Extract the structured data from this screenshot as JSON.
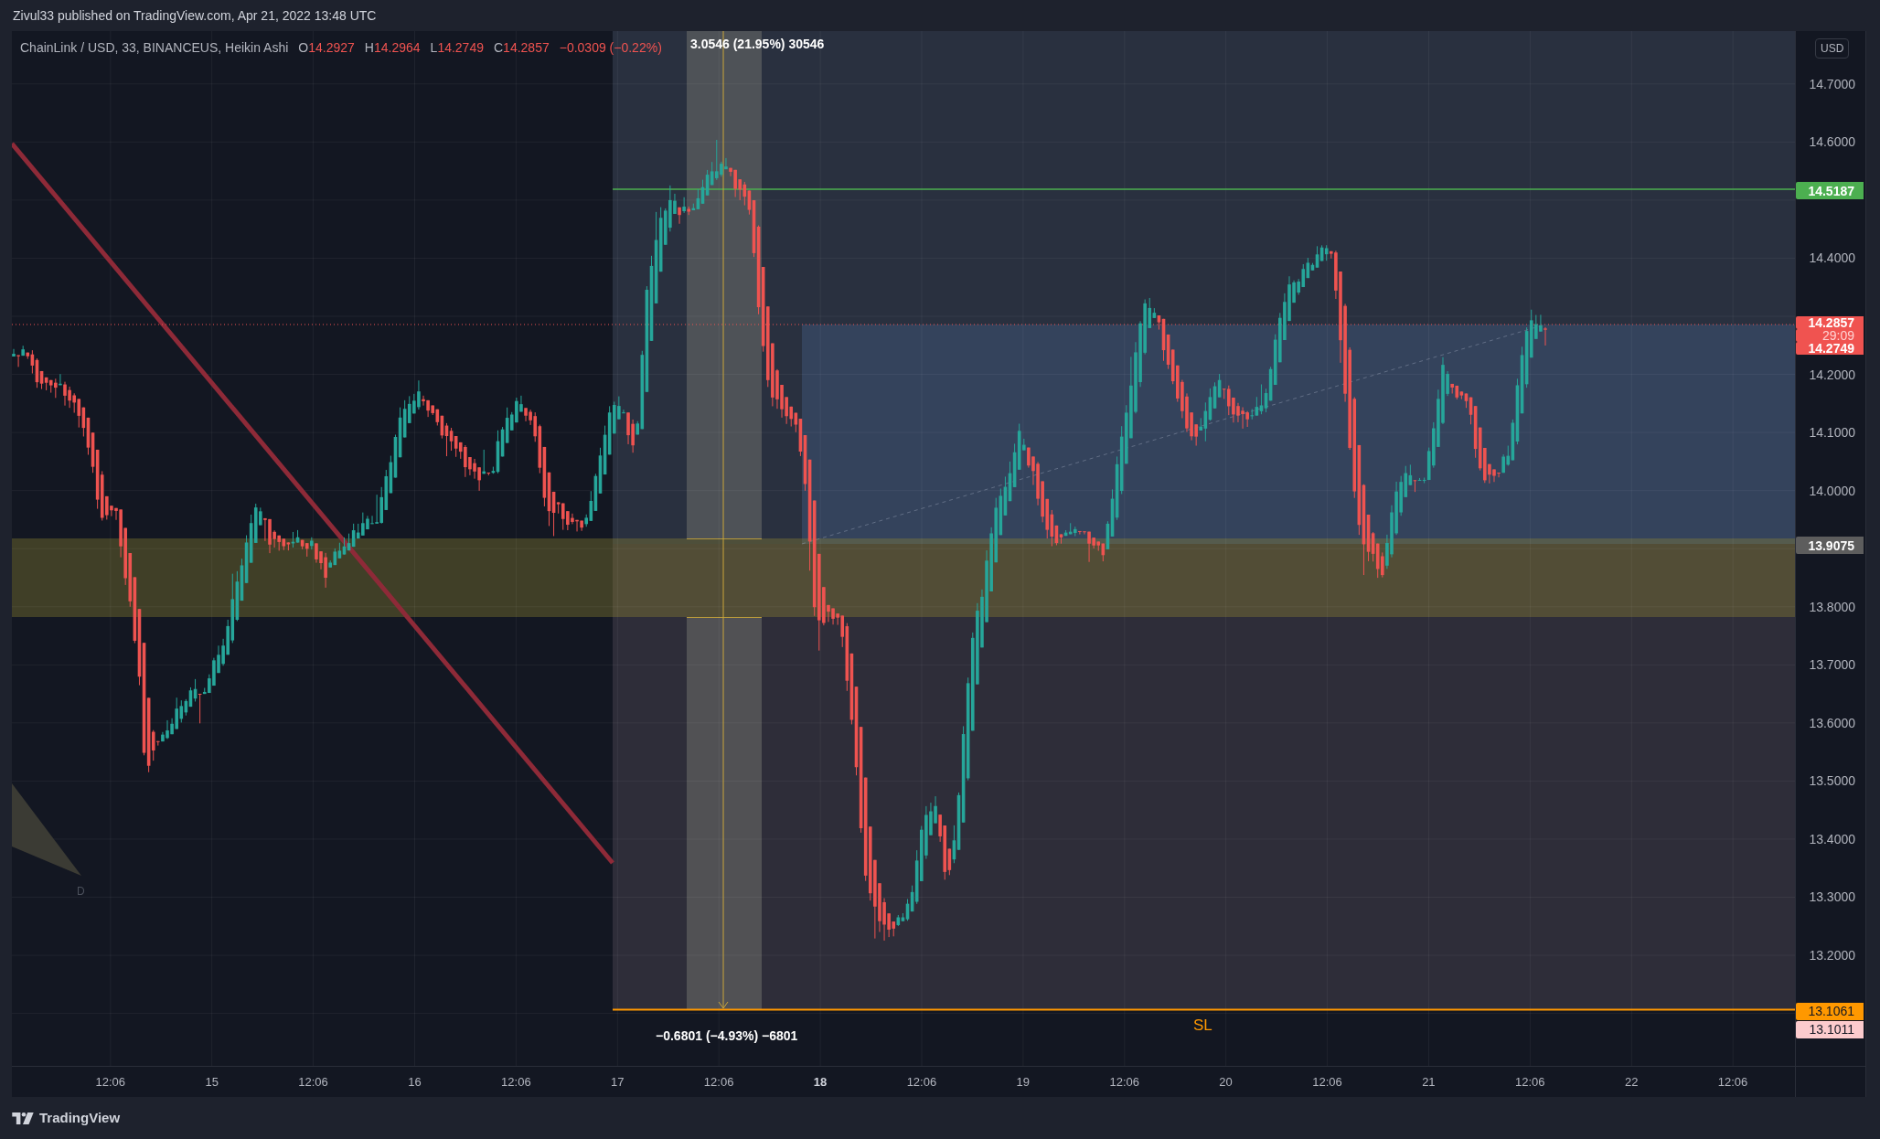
{
  "header": {
    "caption": "Zivul33 published on TradingView.com, Apr 21, 2022 13:48 UTC"
  },
  "legend": {
    "symbol": "ChainLink / USD, 33, BINANCEUS, Heikin Ashi",
    "ohlc": [
      {
        "label": "O",
        "value": "14.2927"
      },
      {
        "label": "H",
        "value": "14.2964"
      },
      {
        "label": "L",
        "value": "14.2749"
      },
      {
        "label": "C",
        "value": "14.2857"
      }
    ],
    "change": "−0.0309 (−0.22%)"
  },
  "drawings": {
    "measure_up": "3.0546 (21.95%) 30546",
    "measure_down": "−0.6801 (−4.93%) −6801",
    "stop_label": "SL",
    "pattern_label": "D"
  },
  "price_axis": {
    "unit": "USD",
    "labels": [
      {
        "kind": "tick",
        "text": "14.7000"
      },
      {
        "kind": "tick",
        "text": "14.6000"
      },
      {
        "kind": "target",
        "text": "14.5187",
        "color": "#4caf50"
      },
      {
        "kind": "tick",
        "text": "14.4000"
      },
      {
        "kind": "last",
        "text": "14.2857",
        "countdown": "29:09",
        "low": "14.2749",
        "color": "#f05350"
      },
      {
        "kind": "tick",
        "text": "14.2000"
      },
      {
        "kind": "tick",
        "text": "14.1000"
      },
      {
        "kind": "tick",
        "text": "14.0000"
      },
      {
        "kind": "entry",
        "text": "13.9075",
        "color": "#5d5d5d"
      },
      {
        "kind": "tick",
        "text": "13.8000"
      },
      {
        "kind": "tick",
        "text": "13.7000"
      },
      {
        "kind": "tick",
        "text": "13.6000"
      },
      {
        "kind": "tick",
        "text": "13.5000"
      },
      {
        "kind": "tick",
        "text": "13.4000"
      },
      {
        "kind": "tick",
        "text": "13.3000"
      },
      {
        "kind": "tick",
        "text": "13.2000"
      },
      {
        "kind": "stop",
        "text": "13.1061",
        "color": "#ff9800"
      },
      {
        "kind": "stop_limit",
        "text": "13.1011",
        "color": "#fccbcd"
      }
    ]
  },
  "time_axis": {
    "ticks": [
      {
        "text": "12:06",
        "highlighted": false
      },
      {
        "text": "15",
        "highlighted": false
      },
      {
        "text": "12:06",
        "highlighted": false
      },
      {
        "text": "16",
        "highlighted": false
      },
      {
        "text": "12:06",
        "highlighted": false
      },
      {
        "text": "17",
        "highlighted": false
      },
      {
        "text": "12:06",
        "highlighted": false
      },
      {
        "text": "18",
        "highlighted": true
      },
      {
        "text": "12:06",
        "highlighted": false
      },
      {
        "text": "19",
        "highlighted": false
      },
      {
        "text": "12:06",
        "highlighted": false
      },
      {
        "text": "20",
        "highlighted": false
      },
      {
        "text": "12:06",
        "highlighted": false
      },
      {
        "text": "21",
        "highlighted": false
      },
      {
        "text": "12:06",
        "highlighted": false
      },
      {
        "text": "22",
        "highlighted": false
      },
      {
        "text": "12:06",
        "highlighted": false
      }
    ]
  },
  "footer": {
    "brand": "TradingView"
  }
}
